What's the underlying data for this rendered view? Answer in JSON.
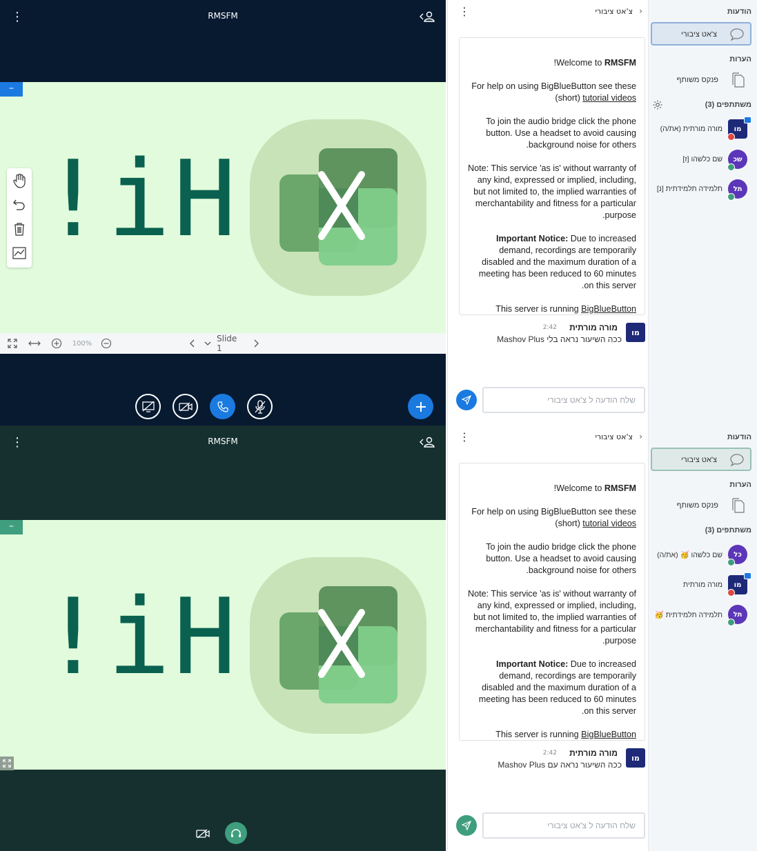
{
  "top": {
    "meeting_title": "RMSFM",
    "minimize_symbol": "–",
    "slide_text": "Hi!",
    "zoom_level": "100%",
    "slide_label": "Slide 1",
    "chat": {
      "title": "צ'אט ציבורי",
      "welcome_prefix": "Welcome to ",
      "meeting_name": "RMSFM",
      "welcome_suffix": "!",
      "help_text": "For help on using BigBlueButton see these (short) ",
      "tutorial_link": "tutorial videos",
      "audio_text": "To join the audio bridge click the phone button. Use a headset to avoid causing background noise for others.",
      "note_text": "Note: This service 'as is' without warranty of any kind, expressed or implied, including, but not limited to, the implied warranties of merchantability and fitness for a particular purpose.",
      "notice_label": "Important Notice:",
      "notice_text": " Due to increased demand, recordings are temporarily disabled and the maximum duration of a meeting has been reduced to 60 minutes on this server.",
      "server_text": "This server is running ",
      "server_link": "BigBlueButton",
      "message": {
        "avatar": "מו",
        "author": "מורה מורתית",
        "time": "2:42",
        "text": "ככה השיעור נראה בלי Mashov Plus"
      },
      "input_placeholder": "שלח הודעה ל צ'אט ציבורי"
    },
    "sidebar": {
      "messages_heading": "הודעות",
      "public_chat_label": "צ'אט ציבורי",
      "notes_heading": "הערות",
      "shared_notes_label": "פנקס משותף",
      "participants_heading": "משתתפים (3)",
      "users": [
        {
          "avatar": "מו",
          "name": "מורה מורתית (את/ה)",
          "color": "#1e2a78",
          "square": true,
          "presenter": true,
          "status": "muted"
        },
        {
          "avatar": "שכ",
          "name": "שם כלשהו [ז]",
          "color": "#5b36b8",
          "square": false,
          "presenter": false,
          "status": "listen"
        },
        {
          "avatar": "תל",
          "name": "תלמידה תלמידתית [נ]",
          "color": "#5b36b8",
          "square": false,
          "presenter": false,
          "status": "listen"
        }
      ]
    }
  },
  "bottom": {
    "meeting_title": "RMSFM",
    "minimize_symbol": "–",
    "slide_text": "Hi!",
    "chat": {
      "title": "צ'אט ציבורי",
      "welcome_prefix": "Welcome to ",
      "meeting_name": "RMSFM",
      "welcome_suffix": "!",
      "help_text": "For help on using BigBlueButton see these (short) ",
      "tutorial_link": "tutorial videos",
      "audio_text": "To join the audio bridge click the phone button. Use a headset to avoid causing background noise for others.",
      "note_text": "Note: This service 'as is' without warranty of any kind, expressed or implied, including, but not limited to, the implied warranties of merchantability and fitness for a particular purpose.",
      "notice_label": "Important Notice:",
      "notice_text": " Due to increased demand, recordings are temporarily disabled and the maximum duration of a meeting has been reduced to 60 minutes on this server.",
      "server_text": "This server is running ",
      "server_link": "BigBlueButton",
      "message": {
        "avatar": "מו",
        "author": "מורה מורתית",
        "time": "2:42",
        "text": "ככה השיעור נראה עם Mashov Plus"
      },
      "input_placeholder": "שלח הודעה ל צ'אט ציבורי"
    },
    "sidebar": {
      "messages_heading": "הודעות",
      "public_chat_label": "צ'אט ציבורי",
      "notes_heading": "הערות",
      "shared_notes_label": "פנקס משותף",
      "participants_heading": "משתתפים (3)",
      "users": [
        {
          "avatar": "כל",
          "name": "שם כלשהו 🥳 (את/ה)",
          "color": "#5b36b8",
          "square": false,
          "presenter": false,
          "status": "listen"
        },
        {
          "avatar": "מו",
          "name": "מורה מורתית",
          "color": "#1e2a78",
          "square": true,
          "presenter": true,
          "status": "muted"
        },
        {
          "avatar": "תל",
          "name": "תלמידה תלמידתית 🥳",
          "color": "#5b36b8",
          "square": false,
          "presenter": false,
          "status": "listen"
        }
      ]
    }
  },
  "colors": {
    "accent_blue": "#1b7ae0",
    "accent_green": "#3f9e7e",
    "top_bg": "#071a30",
    "bottom_bg": "#163030",
    "slide_bg": "#e1fbdc",
    "hi_text": "#0a6150"
  },
  "icons": {
    "kebab": "more-vertical-icon",
    "user_toggle": "user-list-toggle-icon",
    "logo": "excel-logo-icon",
    "tools": [
      "hand-icon",
      "undo-icon",
      "trash-icon",
      "pen-tool-icon"
    ],
    "footer": [
      "fullscreen-icon",
      "fit-width-icon",
      "zoom-in-icon",
      "zoom-out-icon",
      "prev-slide-icon",
      "slide-dropdown-icon",
      "next-slide-icon"
    ]
  }
}
